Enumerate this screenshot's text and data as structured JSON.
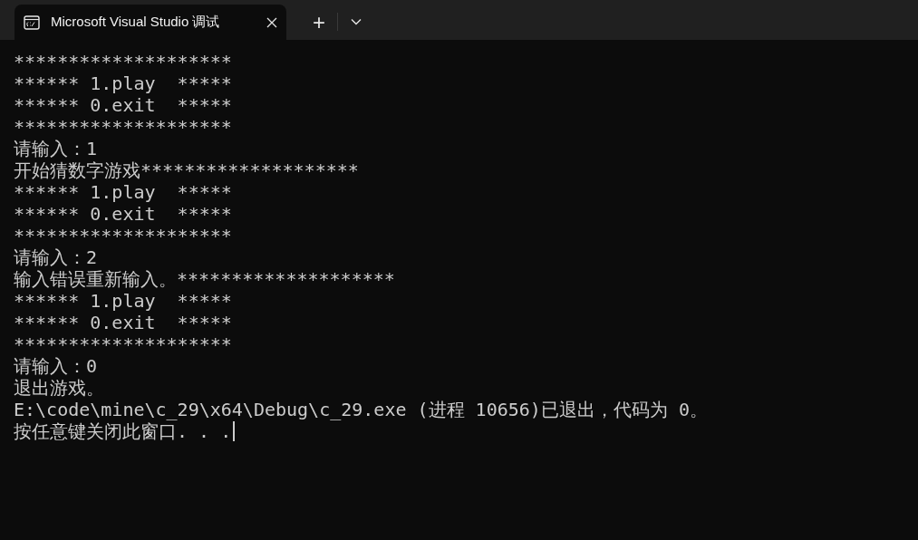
{
  "tab": {
    "title": "Microsoft Visual Studio 调试",
    "selected": true
  },
  "tab_bar": {
    "new_tab": "+"
  },
  "console": {
    "lines": [
      "********************",
      "****** 1.play  *****",
      "****** 0.exit  *****",
      "********************",
      "请输入：1",
      "开始猜数字游戏********************",
      "****** 1.play  *****",
      "****** 0.exit  *****",
      "********************",
      "请输入：2",
      "输入错误重新输入。********************",
      "****** 1.play  *****",
      "****** 0.exit  *****",
      "********************",
      "请输入：0",
      "退出游戏。",
      "E:\\code\\mine\\c_29\\x64\\Debug\\c_29.exe (进程 10656)已退出，代码为 0。",
      "按任意键关闭此窗口. . ."
    ],
    "cursor": true
  }
}
